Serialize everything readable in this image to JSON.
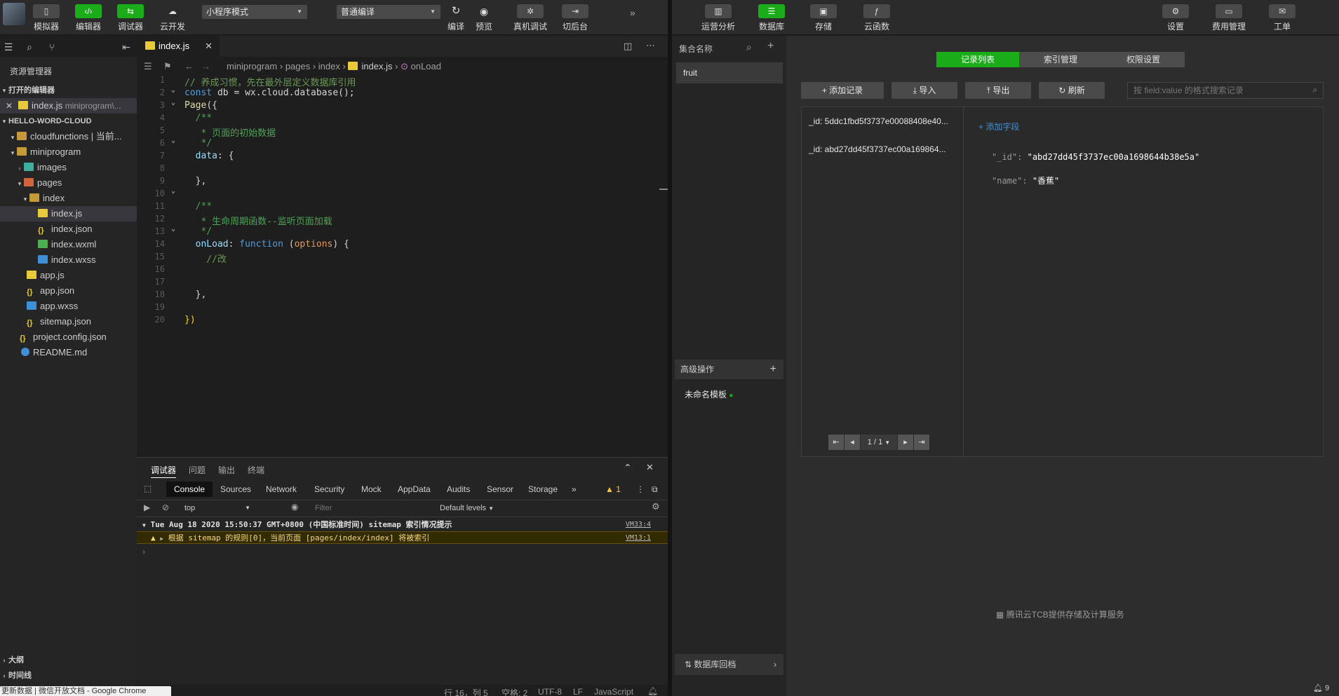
{
  "left_toolbar": {
    "buttons": [
      {
        "label": "模拟器",
        "icon": "phone-icon"
      },
      {
        "label": "编辑器",
        "icon": "code-icon"
      },
      {
        "label": "调试器",
        "icon": "debug-icon"
      },
      {
        "label": "云开发",
        "icon": "cloud-icon"
      }
    ],
    "mode_select": "小程序模式",
    "compile_select": "普通编译",
    "actions": [
      {
        "label": "编译",
        "icon": "refresh-icon"
      },
      {
        "label": "预览",
        "icon": "eye-icon"
      },
      {
        "label": "真机调试",
        "icon": "bug-icon"
      },
      {
        "label": "切后台",
        "icon": "switch-icon"
      }
    ]
  },
  "sidebar": {
    "explorer_title": "资源管理器",
    "open_editors": "打开的编辑器",
    "open_file": "index.js",
    "open_file_path": "miniprogram\\...",
    "project": "HELLO-WORD-CLOUD",
    "tree": [
      {
        "label": "cloudfunctions | 当前...",
        "type": "folder"
      },
      {
        "label": "miniprogram",
        "type": "folder"
      },
      {
        "label": "images",
        "type": "folder-g"
      },
      {
        "label": "pages",
        "type": "folder-r"
      },
      {
        "label": "index",
        "type": "folder"
      },
      {
        "label": "index.js",
        "type": "js"
      },
      {
        "label": "index.json",
        "type": "json"
      },
      {
        "label": "index.wxml",
        "type": "wxml"
      },
      {
        "label": "index.wxss",
        "type": "wxss"
      },
      {
        "label": "app.js",
        "type": "js"
      },
      {
        "label": "app.json",
        "type": "json"
      },
      {
        "label": "app.wxss",
        "type": "wxss"
      },
      {
        "label": "sitemap.json",
        "type": "json"
      },
      {
        "label": "project.config.json",
        "type": "json"
      },
      {
        "label": "README.md",
        "type": "info"
      }
    ],
    "outline": "大纲",
    "timeline": "时间线"
  },
  "editor": {
    "tab": "index.js",
    "breadcrumb": [
      "miniprogram",
      "pages",
      "index",
      "index.js",
      "onLoad"
    ],
    "line_numbers": [
      "1",
      "2",
      "3",
      "4",
      "5",
      "6",
      "7",
      "8",
      "9",
      "10",
      "11",
      "12",
      "13",
      "14",
      "15",
      "16",
      "17",
      "18",
      "19",
      "20"
    ],
    "lines": {
      "l1": "// 养成习惯，先在最外层定义数据库引用",
      "l2_kw": "const",
      "l2_rest": " db = wx.cloud.database();",
      "l3_fn": "Page",
      "l3_rest": "({",
      "l4": "  /**",
      "l5": "   * 页面的初始数据",
      "l6": "   */",
      "l7_prop": "  data",
      "l7_rest": ": {",
      "l9": "  },",
      "l11": "  /**",
      "l12": "   * 生命周期函数--监听页面加载",
      "l13": "   */",
      "l14_prop": "  onLoad",
      "l14_colon": ": ",
      "l14_kw": "function",
      "l14_sp": " (",
      "l14_par": "options",
      "l14_end": ") {",
      "l15": "    //改",
      "l18": "  },",
      "l20": "})"
    }
  },
  "debugger": {
    "tabs": [
      "调试器",
      "问题",
      "输出",
      "终端"
    ],
    "devtools_tabs": [
      "Console",
      "Sources",
      "Network",
      "Security",
      "Mock",
      "AppData",
      "Audits",
      "Sensor",
      "Storage"
    ],
    "warn_count": "1",
    "context": "top",
    "filter_placeholder": "Filter",
    "levels": "Default levels",
    "log_group": "Tue Aug 18 2020 15:50:37 GMT+0800 (中国标准时间) sitemap 索引情况提示",
    "log_group_link": "VM33:4",
    "log_warn": "根据 sitemap 的规则[0]，当前页面 [pages/index/index] 将被索引",
    "log_warn_link": "VM13:1"
  },
  "statusbar": {
    "position": "行 16，列 5",
    "spaces": "空格: 2",
    "encoding": "UTF-8",
    "eol": "LF",
    "language": "JavaScript"
  },
  "taskbar_item": "更新数据 | 微信开放文档 - Google Chrome",
  "right_toolbar": {
    "buttons": [
      {
        "label": "运营分析",
        "icon": "chart-icon"
      },
      {
        "label": "数据库",
        "icon": "database-icon"
      },
      {
        "label": "存储",
        "icon": "storage-icon"
      },
      {
        "label": "云函数",
        "icon": "function-icon"
      }
    ],
    "right_buttons": [
      {
        "label": "设置",
        "icon": "gear-icon"
      },
      {
        "label": "费用管理",
        "icon": "billing-icon"
      },
      {
        "label": "工单",
        "icon": "ticket-icon"
      }
    ]
  },
  "collections": {
    "header": "集合名称",
    "items": [
      "fruit"
    ],
    "advanced": "高级操作",
    "template": "未命名模板",
    "rollback": "数据库回档"
  },
  "database": {
    "tabs": [
      "记录列表",
      "索引管理",
      "权限设置"
    ],
    "actions": [
      "添加记录",
      "导入",
      "导出",
      "刷新"
    ],
    "search_placeholder": "按 field:value 的格式搜索记录",
    "records": [
      "_id: 5ddc1fbd5f3737e00088408e40...",
      "_id: abd27dd45f3737ec00a169864..."
    ],
    "add_field": "添加字段",
    "fields": [
      {
        "key": "\"_id\":",
        "value": "\"abd27dd45f3737ec00a1698644b38e5a\""
      },
      {
        "key": "\"name\":",
        "value": "\"香蕉\""
      }
    ],
    "pagination": "1 / 1",
    "footer": "腾讯云TCB提供存储及计算服务",
    "notify_count": "9"
  }
}
